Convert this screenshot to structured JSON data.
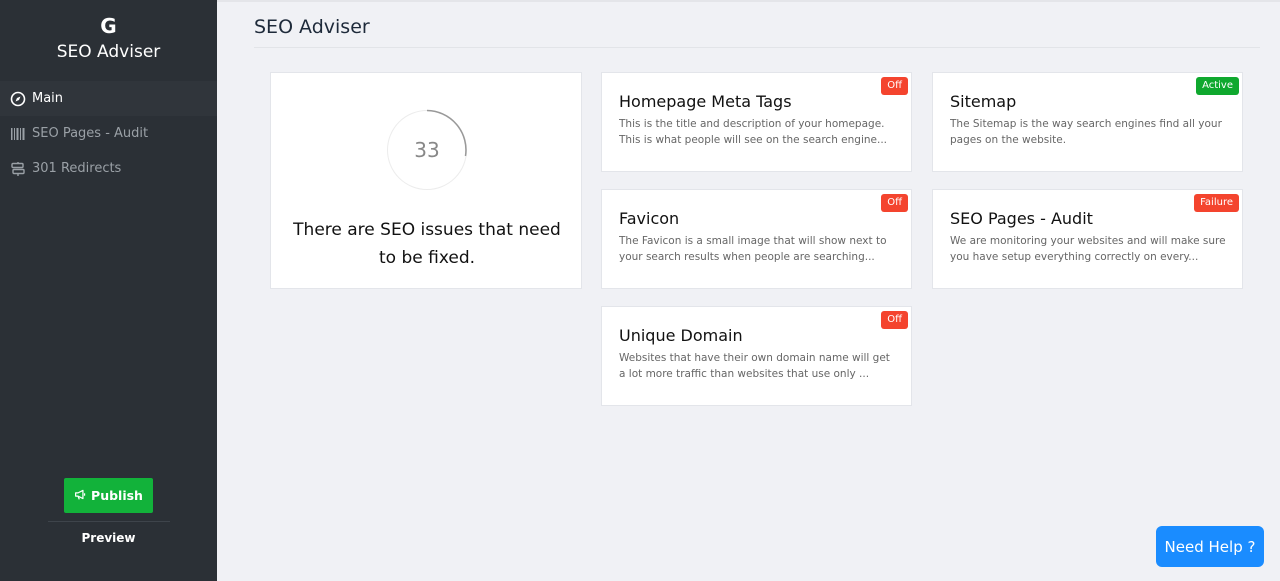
{
  "sidebar": {
    "logo": "G",
    "app_name": "SEO Adviser",
    "items": [
      {
        "label": "Main",
        "icon": "compass-icon",
        "active": true
      },
      {
        "label": "SEO Pages - Audit",
        "icon": "barcode-icon",
        "active": false
      },
      {
        "label": "301 Redirects",
        "icon": "signpost-icon",
        "active": false
      }
    ],
    "publish_label": "Publish",
    "preview_label": "Preview"
  },
  "main": {
    "title": "SEO Adviser",
    "score": {
      "value": "33",
      "message": "There are SEO issues that need to be fixed."
    },
    "cards": [
      {
        "title": "Homepage Meta Tags",
        "description": "This is the title and description of your homepage. This is what people will see on the search engine...",
        "status": "Off"
      },
      {
        "title": "Sitemap",
        "description": "The Sitemap is the way search engines find all your pages on the website.",
        "status": "Active"
      },
      {
        "title": "Favicon",
        "description": "The Favicon is a small image that will show next to your search results when people are searching...",
        "status": "Off"
      },
      {
        "title": "SEO Pages - Audit",
        "description": "We are monitoring your websites and will make sure you have setup everything correctly on every...",
        "status": "Failure"
      },
      {
        "title": "Unique Domain",
        "description": "Websites that have their own domain name will get a lot more traffic than websites that use only ...",
        "status": "Off"
      }
    ]
  },
  "help_label": "Need Help ?",
  "colors": {
    "sidebar_bg": "#2b3036",
    "publish_green": "#12b23a",
    "badge_off": "#f4442e",
    "badge_active": "#0fa82e",
    "help_blue": "#1a8cff"
  }
}
